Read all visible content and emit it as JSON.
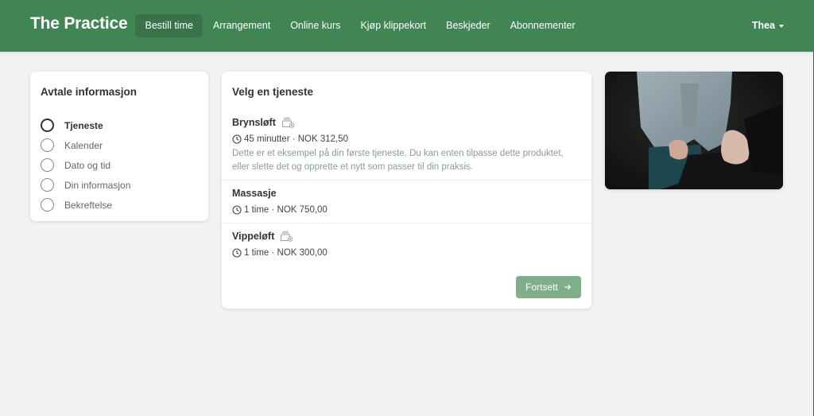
{
  "navbar": {
    "brand": "The Practice",
    "items": [
      {
        "label": "Bestill time",
        "active": true
      },
      {
        "label": "Arrangement",
        "active": false
      },
      {
        "label": "Online kurs",
        "active": false
      },
      {
        "label": "Kjøp klippekort",
        "active": false
      },
      {
        "label": "Beskjeder",
        "active": false
      },
      {
        "label": "Abonnementer",
        "active": false
      }
    ],
    "user": "Thea",
    "user_icon": "caret-down-icon"
  },
  "sidebar": {
    "title": "Avtale informasjon",
    "steps": [
      {
        "label": "Tjeneste",
        "current": true
      },
      {
        "label": "Kalender",
        "current": false
      },
      {
        "label": "Dato og tid",
        "current": false
      },
      {
        "label": "Din informasjon",
        "current": false
      },
      {
        "label": "Bekreftelse",
        "current": false
      }
    ]
  },
  "main": {
    "title": "Velg en tjeneste",
    "services": [
      {
        "name": "Brynsløft",
        "has_card_icon": true,
        "meta": "45 minutter · NOK 312,50",
        "description": "Dette er et eksempel på din første tjeneste. Du kan enten tilpasse dette produktet, eller slette det og opprette et nytt som passer til din praksis."
      },
      {
        "name": "Massasje",
        "has_card_icon": false,
        "meta": "1 time · NOK 750,00"
      },
      {
        "name": "Vippeløft",
        "has_card_icon": true,
        "meta": "1 time · NOK 300,00"
      }
    ],
    "continue_label": "Fortsett"
  },
  "photo": {
    "alt": "Two people sitting facing each other, hands clasped"
  },
  "colors": {
    "brand": "#428555",
    "brand_active": "#3a7249",
    "button": "#7fae8a",
    "description": "#8a9aa6",
    "background": "#f2f2f2"
  }
}
